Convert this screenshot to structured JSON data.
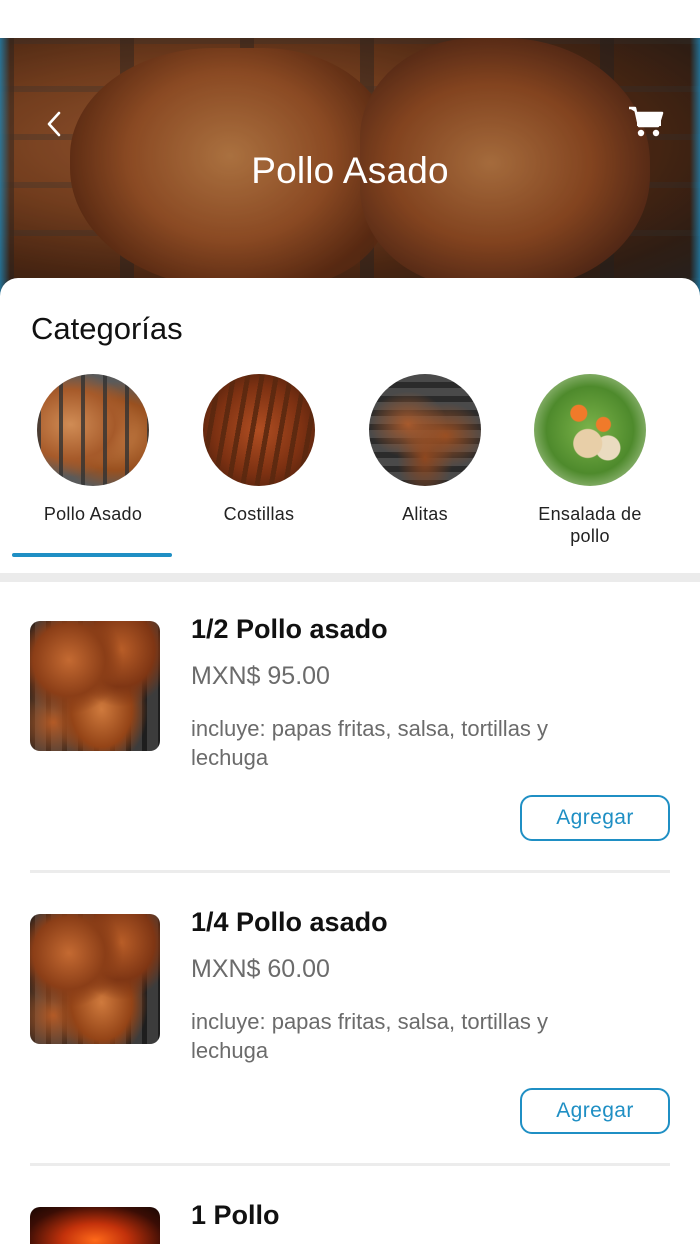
{
  "header": {
    "title": "Pollo Asado",
    "back_icon": "chevron-left-icon",
    "cart_icon": "shopping-cart-icon"
  },
  "categories": {
    "heading": "Categorías",
    "active_index": 0,
    "accent_color": "#1f8fc4",
    "items": [
      {
        "label": "Pollo Asado"
      },
      {
        "label": "Costillas"
      },
      {
        "label": "Alitas"
      },
      {
        "label": "Ensalada de pollo"
      }
    ]
  },
  "products": [
    {
      "name": "1/2 Pollo asado",
      "price": "MXN$ 95.00",
      "description": "incluye: papas fritas, salsa, tortillas y lechuga",
      "add_label": "Agregar"
    },
    {
      "name": "1/4 Pollo asado",
      "price": "MXN$ 60.00",
      "description": "incluye: papas fritas, salsa, tortillas y lechuga",
      "add_label": "Agregar"
    },
    {
      "name": "1 Pollo"
    }
  ]
}
